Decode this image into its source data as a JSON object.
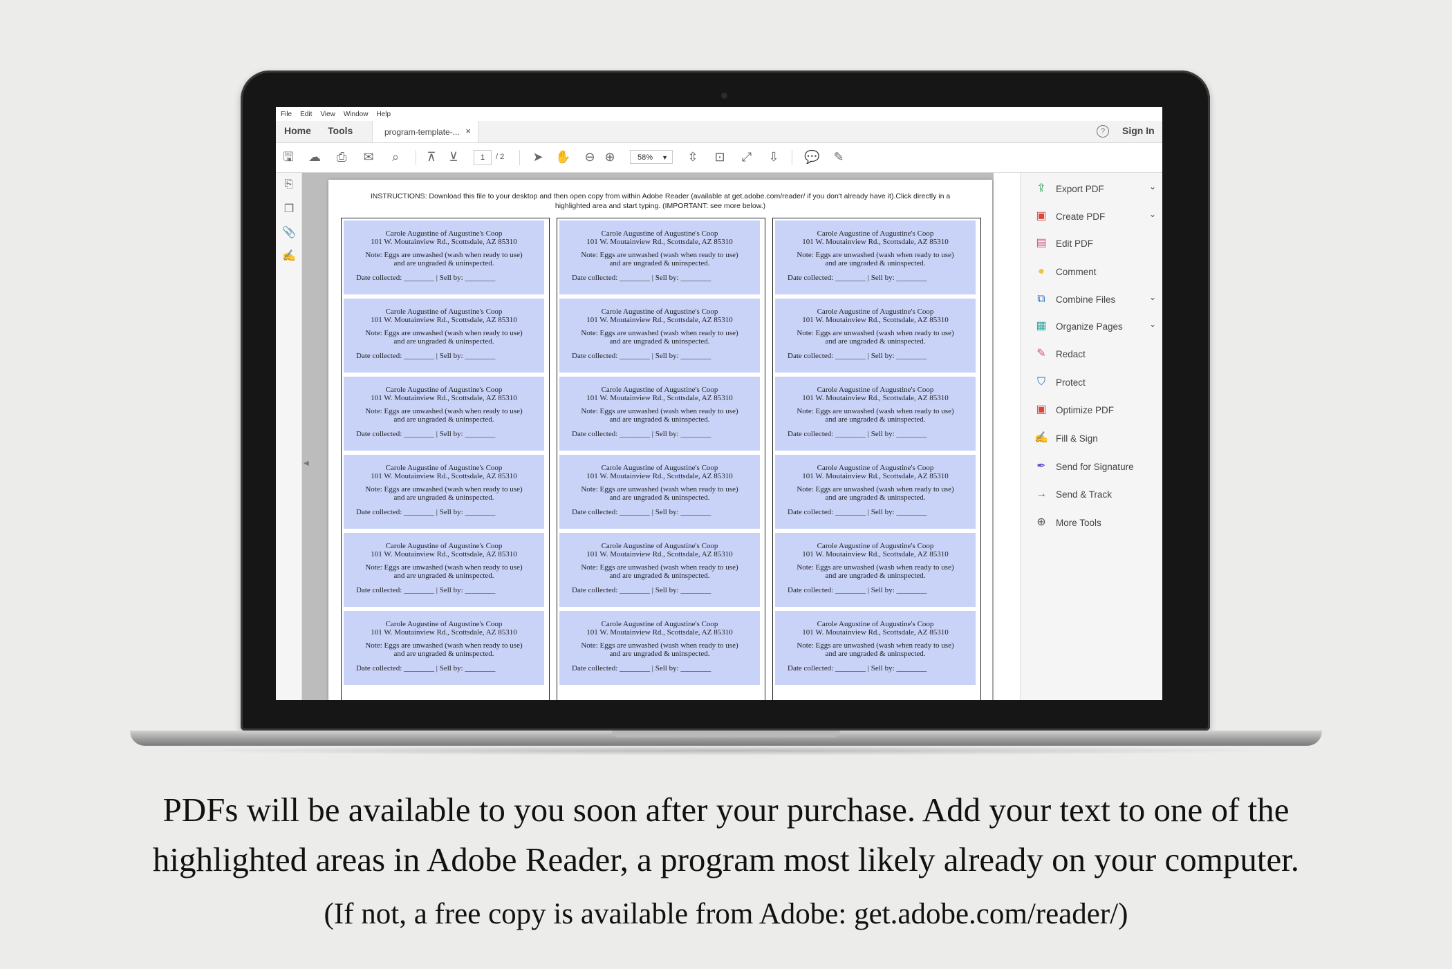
{
  "menu": [
    "File",
    "Edit",
    "View",
    "Window",
    "Help"
  ],
  "tabs": {
    "home": "Home",
    "tools": "Tools",
    "document": "program-template-...",
    "close": "×"
  },
  "header": {
    "help": "?",
    "signin": "Sign In"
  },
  "toolbar": {
    "page_current": "1",
    "page_total": "/ 2",
    "zoom": "58%"
  },
  "document": {
    "instructions": "INSTRUCTIONS: Download this file to your desktop and then open copy from within Adobe Reader (available at get.adobe.com/reader/ if you don't already have it).Click directly in a highlighted area and start typing. (IMPORTANT: see more below.)",
    "label": {
      "line1": "Carole Augustine of Augustine's Coop",
      "line2": "101 W. Moutainview Rd., Scottsdale, AZ 85310",
      "line3": "Note: Eggs are unwashed (wash when ready to use)",
      "line4": "and are ungraded & uninspected.",
      "line5": "Date collected: ________ | Sell by: ________"
    }
  },
  "tools_panel": [
    {
      "label": "Export PDF",
      "icon": "export-pdf-icon",
      "glyph": "⇪",
      "color": "#2e9e5b",
      "chevron": true
    },
    {
      "label": "Create PDF",
      "icon": "create-pdf-icon",
      "glyph": "▣",
      "color": "#d9463b",
      "chevron": true
    },
    {
      "label": "Edit PDF",
      "icon": "edit-pdf-icon",
      "glyph": "▤",
      "color": "#d94a86",
      "chevron": false
    },
    {
      "label": "Comment",
      "icon": "comment-icon",
      "glyph": "●",
      "color": "#f3c23b",
      "chevron": false
    },
    {
      "label": "Combine Files",
      "icon": "combine-files-icon",
      "glyph": "⧉",
      "color": "#2b72c9",
      "chevron": true
    },
    {
      "label": "Organize Pages",
      "icon": "organize-pages-icon",
      "glyph": "▦",
      "color": "#2fa8a0",
      "chevron": true
    },
    {
      "label": "Redact",
      "icon": "redact-icon",
      "glyph": "✎",
      "color": "#d94a86",
      "chevron": false
    },
    {
      "label": "Protect",
      "icon": "protect-icon",
      "glyph": "⛉",
      "color": "#2b72c9",
      "chevron": false
    },
    {
      "label": "Optimize PDF",
      "icon": "optimize-pdf-icon",
      "glyph": "▣",
      "color": "#d9463b",
      "chevron": false
    },
    {
      "label": "Fill & Sign",
      "icon": "fill-sign-icon",
      "glyph": "✍",
      "color": "#7a5cc9",
      "chevron": false
    },
    {
      "label": "Send for Signature",
      "icon": "send-signature-icon",
      "glyph": "✒",
      "color": "#5a4fc9",
      "chevron": false
    },
    {
      "label": "Send & Track",
      "icon": "send-track-icon",
      "glyph": "→",
      "color": "#2b72c9",
      "chevron": false
    },
    {
      "label": "More Tools",
      "icon": "more-tools-icon",
      "glyph": "⊕",
      "color": "#555555",
      "chevron": false
    }
  ],
  "caption": {
    "line1": "PDFs will be available to you soon after your purchase.  Add your text to one of the",
    "line2": "highlighted areas in Adobe Reader, a program most likely already on your computer.",
    "line3": "(If not, a free copy is available from Adobe: get.adobe.com/reader/)"
  }
}
